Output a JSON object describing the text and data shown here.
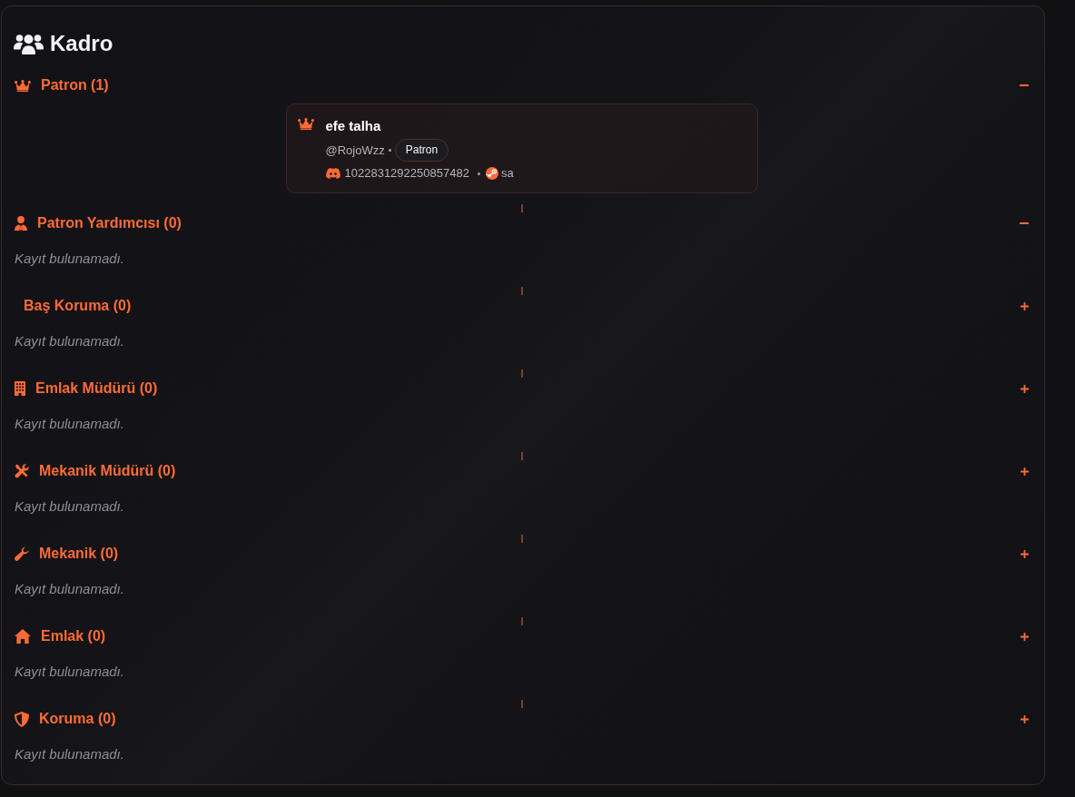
{
  "title": "Kadro",
  "sections": [
    {
      "kind": "boss",
      "title": "Patron (1)",
      "expanded": true,
      "members": [
        {
          "name": "efe talha",
          "username": "@RojoWzz",
          "role": "Patron",
          "discord_id": "1022831292250857482",
          "steam_name": "sa"
        }
      ]
    },
    {
      "kind": "deputy",
      "title": "Patron Yardımcısı (0)",
      "expanded": true,
      "empty_text": "Kayıt bulunamadı."
    },
    {
      "kind": "headguard",
      "title": "Baş Koruma (0)",
      "expanded": false,
      "empty_text": "Kayıt bulunamadı."
    },
    {
      "kind": "estatemanager",
      "title": "Emlak Müdürü (0)",
      "expanded": false,
      "empty_text": "Kayıt bulunamadı."
    },
    {
      "kind": "mechanicmanager",
      "title": "Mekanik Müdürü (0)",
      "expanded": false,
      "empty_text": "Kayıt bulunamadı."
    },
    {
      "kind": "mechanic",
      "title": "Mekanik (0)",
      "expanded": false,
      "empty_text": "Kayıt bulunamadı."
    },
    {
      "kind": "estate",
      "title": "Emlak (0)",
      "expanded": false,
      "empty_text": "Kayıt bulunamadı."
    },
    {
      "kind": "guard",
      "title": "Koruma (0)",
      "expanded": false,
      "empty_text": "Kayıt bulunamadı."
    }
  ]
}
